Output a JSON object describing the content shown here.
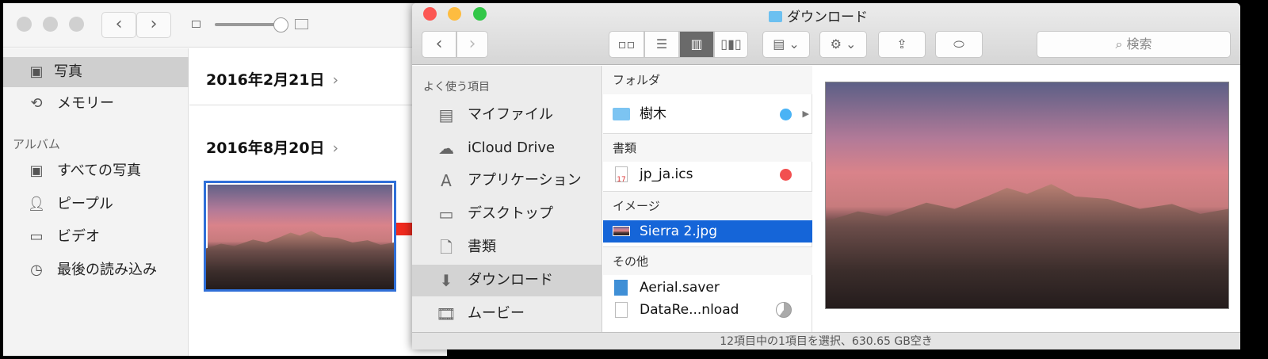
{
  "photos": {
    "sidebar": {
      "items": [
        {
          "label": "写真",
          "icon": "photos-icon",
          "selected": true
        },
        {
          "label": "メモリー",
          "icon": "memories-icon"
        }
      ],
      "section": "アルバム",
      "albums": [
        {
          "label": "すべての写真",
          "icon": "photos-icon"
        },
        {
          "label": "ピープル",
          "icon": "person-icon"
        },
        {
          "label": "ビデオ",
          "icon": "video-icon"
        },
        {
          "label": "最後の読み込み",
          "icon": "clock-icon"
        }
      ]
    },
    "dates": [
      "2016年2月21日",
      "2016年8月20日"
    ],
    "chevron": "›"
  },
  "finder": {
    "title": "ダウンロード",
    "search_placeholder": "検索",
    "sidebar": {
      "section": "よく使う項目",
      "items": [
        {
          "label": "マイファイル"
        },
        {
          "label": "iCloud Drive"
        },
        {
          "label": "アプリケーション"
        },
        {
          "label": "デスクトップ"
        },
        {
          "label": "書類"
        },
        {
          "label": "ダウンロード",
          "selected": true
        },
        {
          "label": "ムービー"
        }
      ]
    },
    "column": {
      "groups": [
        {
          "label": "フォルダ",
          "items": [
            {
              "name": "樹木",
              "tag": "#4ab3f5"
            }
          ]
        },
        {
          "label": "書類",
          "items": [
            {
              "name": "jp_ja.ics",
              "tag": "#f25050"
            }
          ]
        },
        {
          "label": "イメージ",
          "items": [
            {
              "name": "Sierra 2.jpg",
              "selected": true
            }
          ]
        },
        {
          "label": "その他",
          "items": [
            {
              "name": "Aerial.saver"
            },
            {
              "name": "DataRe...nload"
            }
          ]
        }
      ]
    },
    "status": "12項目中の1項目を選択、630.65 GB空き",
    "colors": {
      "selection": "#1565d8",
      "arrow": "#f02a1e"
    }
  }
}
